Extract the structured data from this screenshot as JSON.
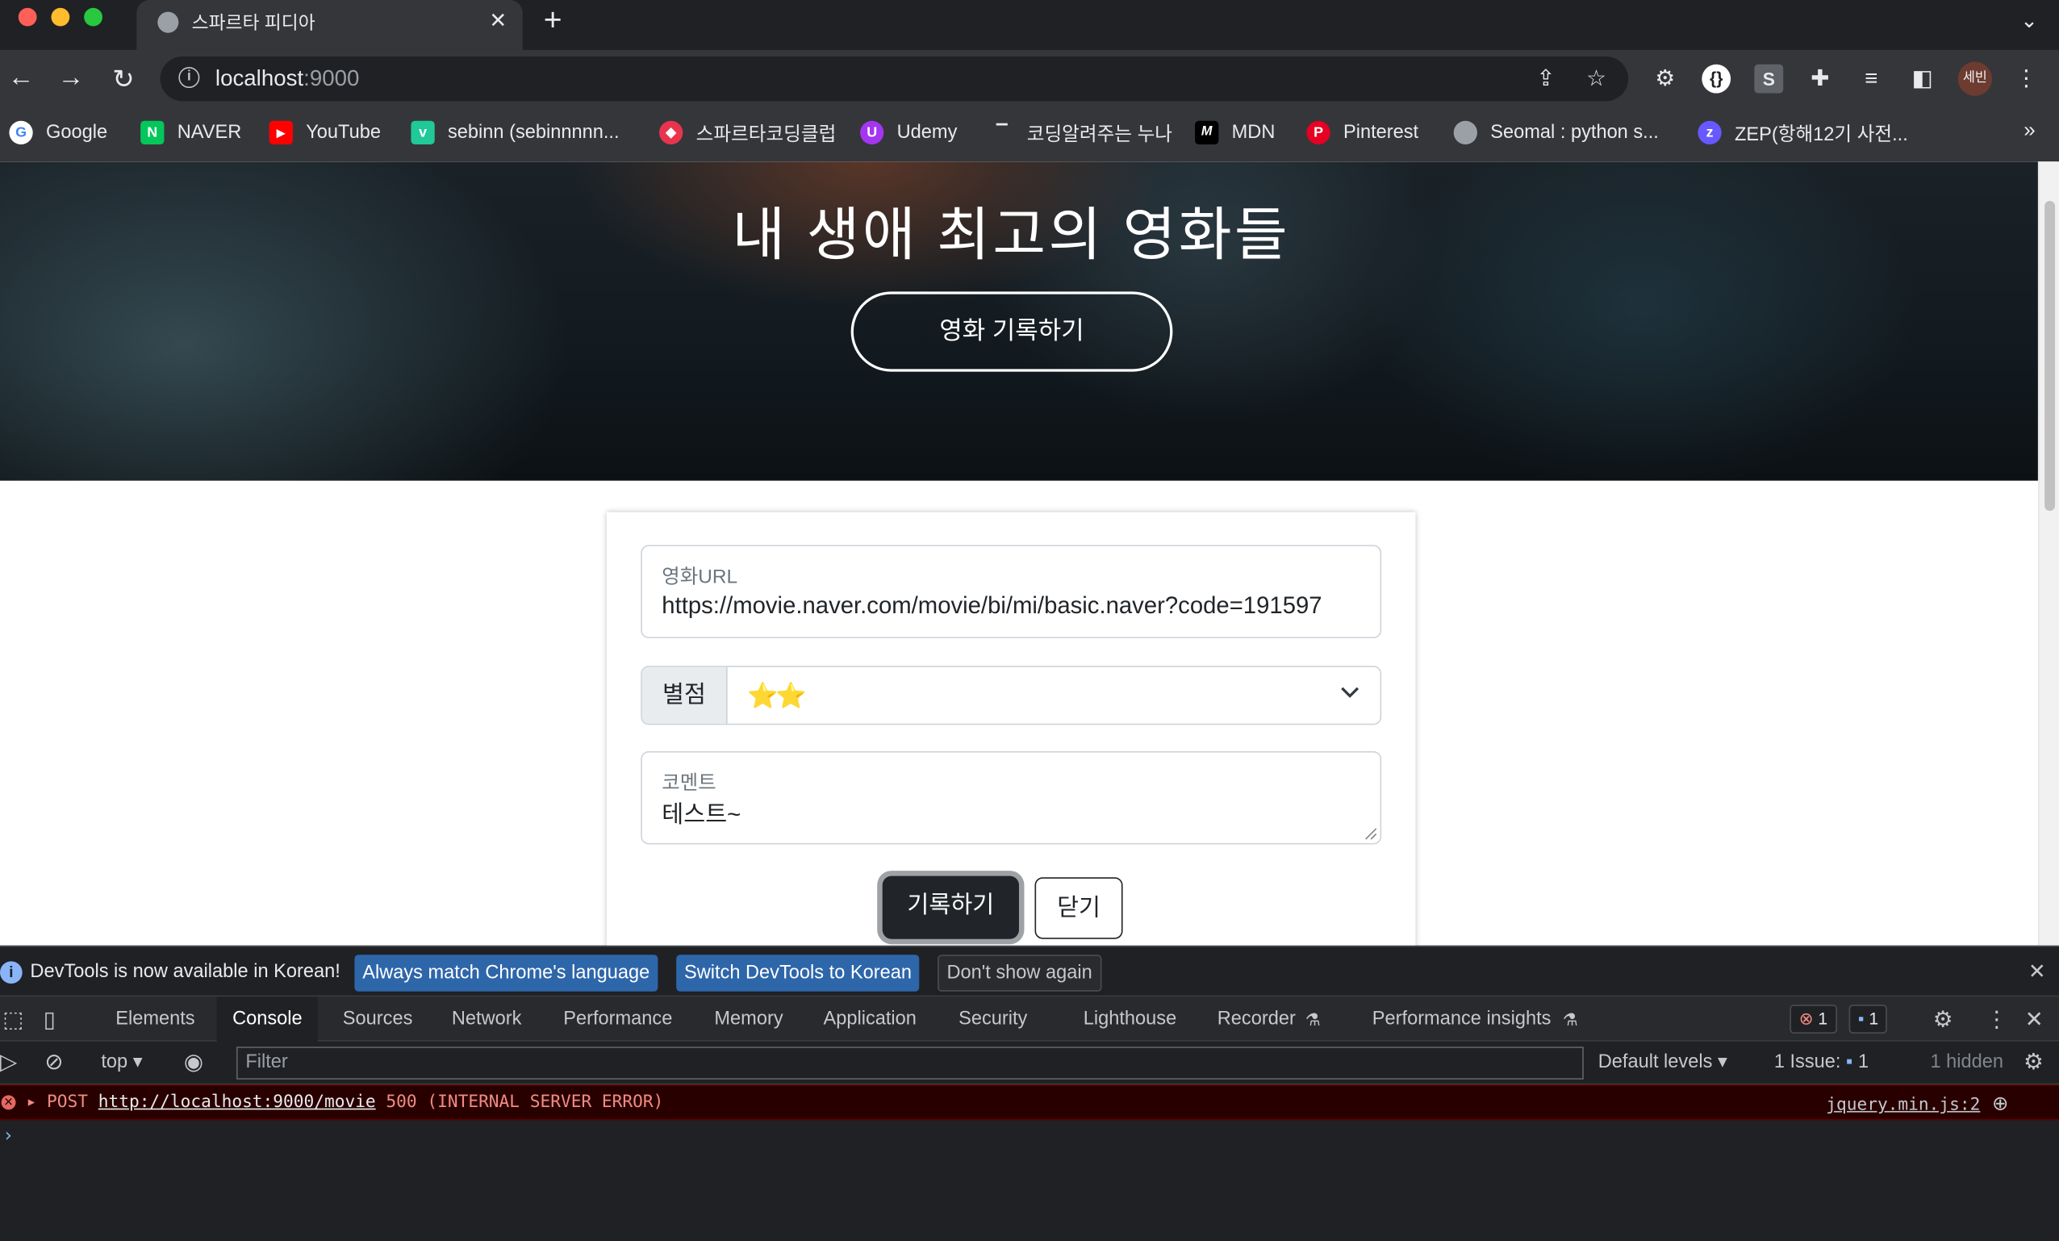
{
  "browser": {
    "tab_title": "스파르타 피디아",
    "url_host": "localhost",
    "url_port": ":9000",
    "profile_initials": "세빈"
  },
  "bookmarks": [
    {
      "label": "Google",
      "icon": "google-icon",
      "color": "#ffffff"
    },
    {
      "label": "NAVER",
      "icon": "naver-icon",
      "color": "#03c75a"
    },
    {
      "label": "YouTube",
      "icon": "youtube-icon",
      "color": "#ff0000"
    },
    {
      "label": "sebinn (sebinnnnn...",
      "icon": "velog-icon",
      "color": "#20c997"
    },
    {
      "label": "스파르타코딩클럽",
      "icon": "sparta-icon",
      "color": "#e8344e"
    },
    {
      "label": "Udemy",
      "icon": "udemy-icon",
      "color": "#a435f0"
    },
    {
      "label": "코딩알려주는 누나",
      "icon": "bookmark-icon",
      "color": "#35363a"
    },
    {
      "label": "MDN",
      "icon": "mdn-icon",
      "color": "#000000"
    },
    {
      "label": "Pinterest",
      "icon": "pinterest-icon",
      "color": "#e60023"
    },
    {
      "label": "Seomal : python s...",
      "icon": "globe-icon",
      "color": "#9aa0a6"
    },
    {
      "label": "ZEP(항해12기 사전...",
      "icon": "zep-icon",
      "color": "#6758ff"
    }
  ],
  "page": {
    "hero_title": "내 생애 최고의 영화들",
    "hero_button": "영화 기록하기",
    "form": {
      "url_label": "영화URL",
      "url_value": "https://movie.naver.com/movie/bi/mi/basic.naver?code=191597",
      "rating_prefix": "별점",
      "rating_value": "⭐⭐",
      "comment_label": "코멘트",
      "comment_value": "테스트~",
      "submit_label": "기록하기",
      "close_label": "닫기"
    }
  },
  "devtools": {
    "info_text": "DevTools is now available in Korean!",
    "info_btn_match": "Always match Chrome's language",
    "info_btn_switch": "Switch DevTools to Korean",
    "info_btn_dismiss": "Don't show again",
    "tabs": [
      "Elements",
      "Console",
      "Sources",
      "Network",
      "Performance",
      "Memory",
      "Application",
      "Security",
      "Lighthouse",
      "Recorder",
      "Performance insights"
    ],
    "error_count": "1",
    "message_count": "1",
    "context": "top",
    "filter_placeholder": "Filter",
    "levels": "Default levels",
    "issues_label": "1 Issue:",
    "issues_count": "1",
    "hidden_label": "1 hidden",
    "console_error": {
      "method": "POST ",
      "url": "http://localhost:9000/movie",
      "status": " 500 (INTERNAL SERVER ERROR)",
      "source": "jquery.min.js:2"
    }
  }
}
